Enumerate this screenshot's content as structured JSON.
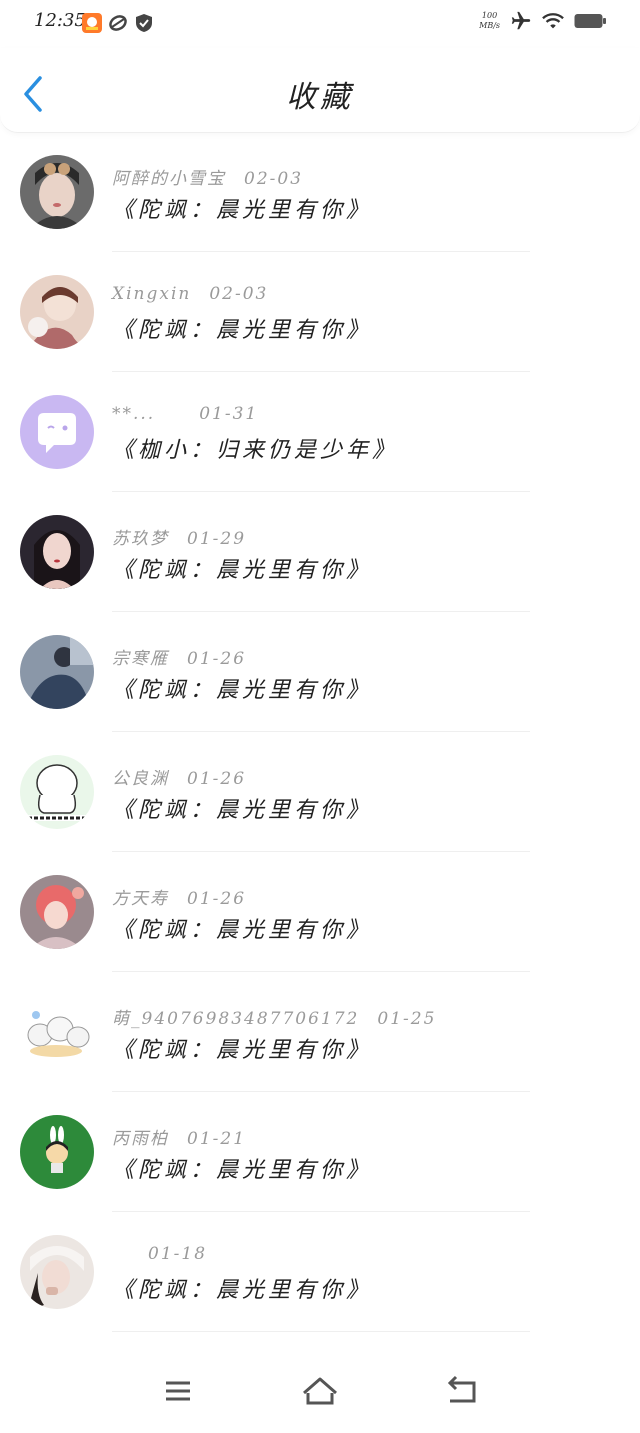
{
  "status_bar": {
    "time": "12:35",
    "speed_value": "100",
    "speed_unit": "MB/s"
  },
  "header": {
    "title": "收藏"
  },
  "colors": {
    "accent": "#2a8fe0",
    "meta_text": "#9a9a9a",
    "title_text": "#222222"
  },
  "items": [
    {
      "user": "阿醉的小雪宝",
      "date": "02-03",
      "title": "《陀飒：晨光里有你》",
      "avatar": "photo"
    },
    {
      "user": "Xingxin",
      "date": "02-03",
      "title": "《陀飒：晨光里有你》",
      "avatar": "illustration"
    },
    {
      "user": "**...",
      "date": "01-31",
      "title": "《枷小：归来仍是少年》",
      "avatar": "chat-bubble-icon"
    },
    {
      "user": "苏玖梦",
      "date": "01-29",
      "title": "《陀飒：晨光里有你》",
      "avatar": "photo"
    },
    {
      "user": "宗寒雁",
      "date": "01-26",
      "title": "《陀飒：晨光里有你》",
      "avatar": "photo"
    },
    {
      "user": "公良渊",
      "date": "01-26",
      "title": "《陀飒：晨光里有你》",
      "avatar": "sketch"
    },
    {
      "user": "方天寿",
      "date": "01-26",
      "title": "《陀飒：晨光里有你》",
      "avatar": "illustration"
    },
    {
      "user": "萌_940769834877061​72",
      "date": "01-25",
      "title": "《陀飒：晨光里有你》",
      "avatar": "cartoon"
    },
    {
      "user": "丙雨柏",
      "date": "01-21",
      "title": "《陀飒：晨光里有你》",
      "avatar": "cartoon"
    },
    {
      "user": "",
      "date": "01-18",
      "title": "《陀飒：晨光里有你》",
      "avatar": "photo"
    }
  ]
}
